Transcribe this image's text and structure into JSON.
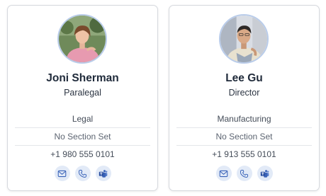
{
  "cards": [
    {
      "name": "Joni Sherman",
      "title": "Paralegal",
      "department": "Legal",
      "section": "No Section Set",
      "phone": "+1 980 555 0101"
    },
    {
      "name": "Lee Gu",
      "title": "Director",
      "department": "Manufacturing",
      "section": "No Section Set",
      "phone": "+1 913 555 0101"
    }
  ],
  "colors": {
    "card_border": "#d6d9de",
    "avatar_ring": "#b9ccea",
    "action_bg": "#e2eaf7",
    "action_icon": "#3a63b8"
  },
  "icons": [
    "mail-icon",
    "phone-icon",
    "teams-icon"
  ]
}
